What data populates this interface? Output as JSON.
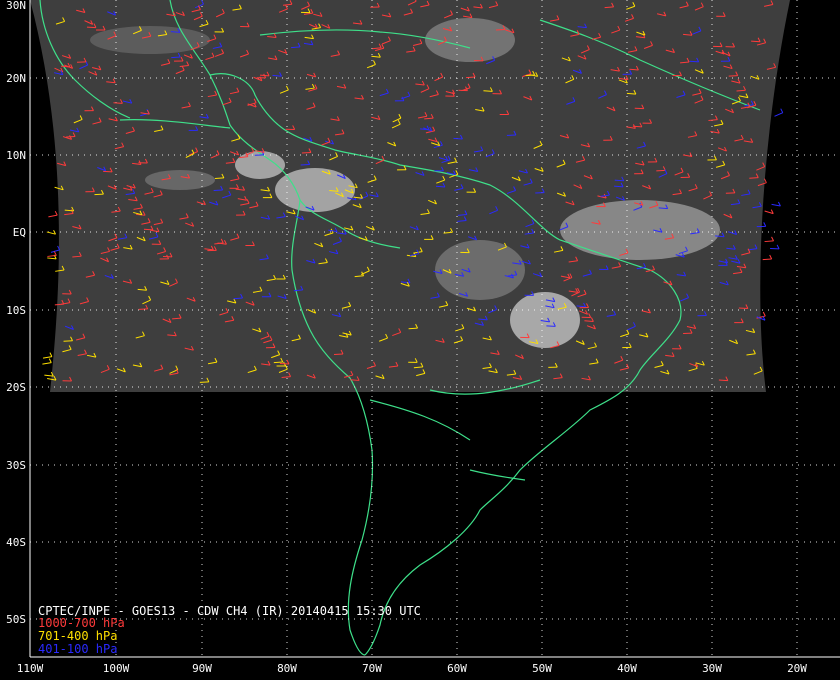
{
  "title": "CPTEC/INPE - GOES13 - CDW CH4 (IR) 20140415 15:30 UTC",
  "legend": [
    {
      "label": "1000-700 hPa",
      "color": "#ff3b3b"
    },
    {
      "label": "701-400 hPa",
      "color": "#ffe000"
    },
    {
      "label": "401-100 hPa",
      "color": "#2a2aff"
    }
  ],
  "lat_labels": [
    "30N",
    "20N",
    "10N",
    "EQ",
    "10S",
    "20S",
    "30S",
    "40S",
    "50S"
  ],
  "lon_labels": [
    "110W",
    "100W",
    "90W",
    "80W",
    "70W",
    "60W",
    "50W",
    "40W",
    "30W",
    "20W"
  ],
  "colors": {
    "coastline": "#3ee08a",
    "grid": "#ffffff",
    "imagery": "#3c3c3c",
    "background": "#000000"
  }
}
